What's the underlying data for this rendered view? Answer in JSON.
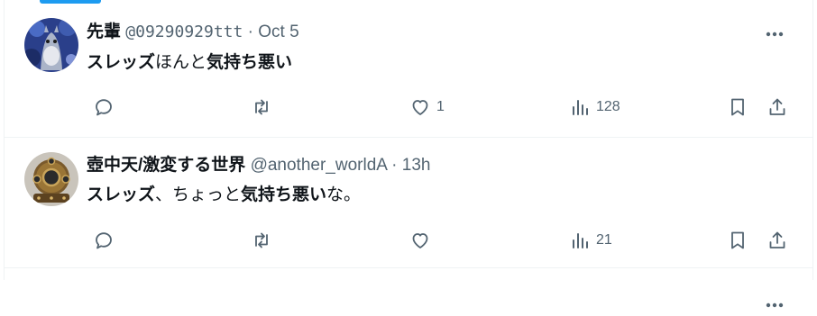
{
  "tweets": [
    {
      "name": "先輩",
      "handle": "@09290929ttt",
      "separator": "·",
      "time": "Oct 5",
      "text_parts": [
        {
          "text": "スレッズ",
          "bold": true
        },
        {
          "text": "ほんと",
          "bold": false
        },
        {
          "text": "気持ち悪い",
          "bold": true
        }
      ],
      "reply_count": "",
      "retweet_count": "",
      "like_count": "1",
      "view_count": "128",
      "avatar_icon": "user-avatar-totoro"
    },
    {
      "name": "壺中天/激変する世界",
      "handle": "@another_worldA",
      "separator": "·",
      "time": "13h",
      "text_parts": [
        {
          "text": "スレッズ",
          "bold": true
        },
        {
          "text": "、ちょっと",
          "bold": false
        },
        {
          "text": "気持ち悪い",
          "bold": true
        },
        {
          "text": "な。",
          "bold": false
        }
      ],
      "reply_count": "",
      "retweet_count": "",
      "like_count": "",
      "view_count": "21",
      "avatar_icon": "user-avatar-diving-helmet"
    }
  ],
  "colors": {
    "accent": "#1d9bf0",
    "text": "#0f1419",
    "secondary": "#536471",
    "border": "#eff3f4"
  }
}
